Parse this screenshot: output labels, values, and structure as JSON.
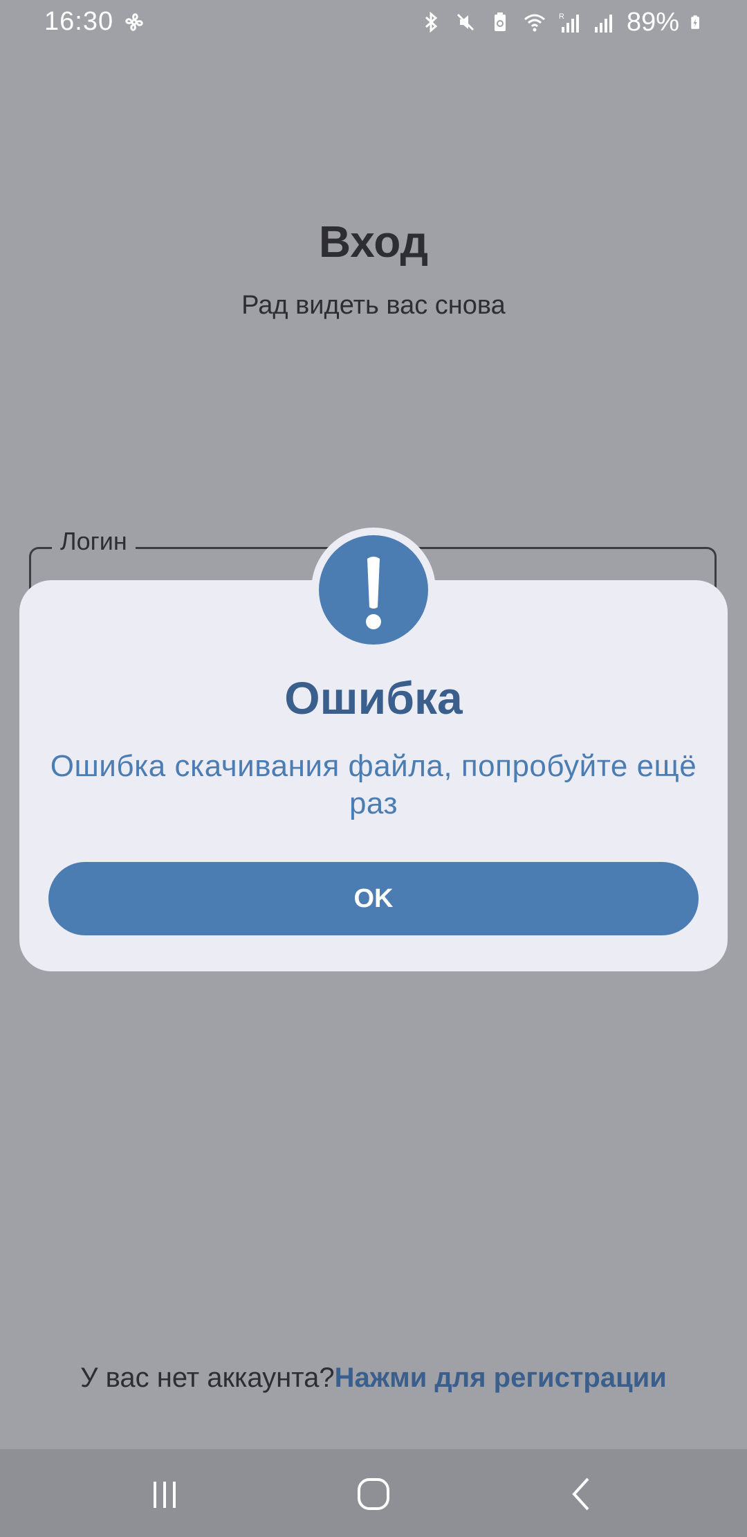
{
  "status_bar": {
    "time": "16:30",
    "battery_text": "89%",
    "icons": [
      "fan-icon",
      "bluetooth-icon",
      "mute-icon",
      "battery-saver-icon",
      "wifi-icon",
      "signal-r-icon",
      "signal-icon",
      "battery-charging-icon"
    ]
  },
  "login": {
    "title": "Вход",
    "subtitle": "Рад видеть вас снова",
    "login_label": "Логин"
  },
  "dialog": {
    "icon": "exclamation-icon",
    "title": "Ошибка",
    "message": "Ошибка скачивания файла, попробуйте ещё раз",
    "ok_label": "OK"
  },
  "register": {
    "prompt": "У вас нет аккаунта?",
    "link": "Нажми для регистрации"
  },
  "nav_bar": {
    "icons": [
      "recent-apps-icon",
      "home-icon",
      "back-icon"
    ]
  },
  "colors": {
    "accent": "#4b7db3",
    "accent_dark": "#3a5f8d",
    "dialog_bg": "#ebecf4",
    "scrim_bg": "#a0a1a6"
  }
}
